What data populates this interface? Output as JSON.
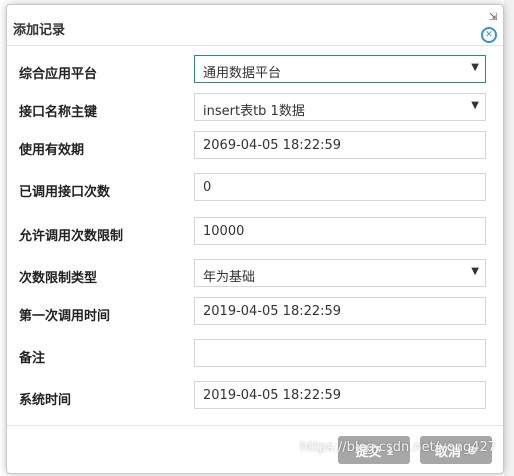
{
  "dialog": {
    "title": "添加记录",
    "close_icon": "close-icon",
    "resize_icon": "resize-icon"
  },
  "form": {
    "rows": [
      {
        "label": "综合应用平台",
        "value": "通用数据平台",
        "type": "select",
        "active": true
      },
      {
        "label": "接口名称主键",
        "value": "insert表tb  1数据",
        "type": "select"
      },
      {
        "label": "使用有效期",
        "value": "2069-04-05 18:22:59",
        "type": "input"
      },
      {
        "label": "已调用接口次数",
        "value": "0",
        "type": "input"
      },
      {
        "label": "允许调用次数限制",
        "value": "10000",
        "type": "input"
      },
      {
        "label": "次数限制类型",
        "value": "年为基础",
        "type": "select"
      },
      {
        "label": "第一次调用时间",
        "value": "2019-04-05 18:22:59",
        "type": "input"
      },
      {
        "label": "备注",
        "value": "",
        "type": "input"
      },
      {
        "label": "系统时间",
        "value": "2019-04-05 18:22:59",
        "type": "input"
      }
    ]
  },
  "buttons": {
    "submit": "提交",
    "submit_icon": "download-icon",
    "cancel": "取消",
    "cancel_icon": "cancel-circle-icon"
  },
  "watermark": "https://blog.csdn.net/yong427"
}
